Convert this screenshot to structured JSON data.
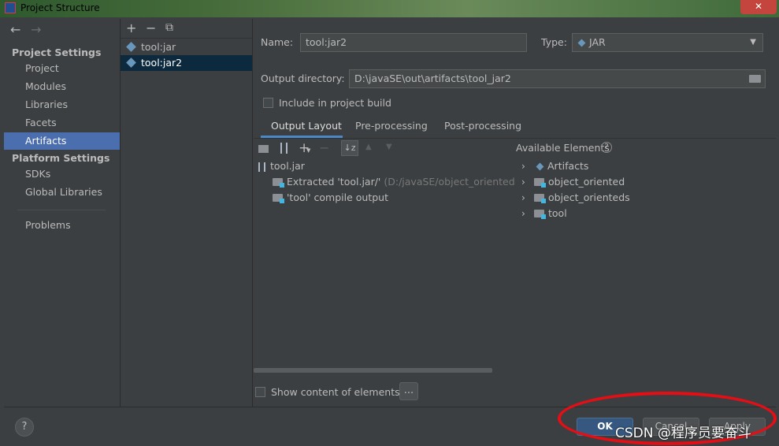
{
  "window": {
    "title": "Project Structure",
    "close_label": "✕"
  },
  "nav": {
    "back_icon": "←",
    "forward_icon": "→",
    "project_settings_header": "Project Settings",
    "project_items": [
      "Project",
      "Modules",
      "Libraries",
      "Facets",
      "Artifacts"
    ],
    "selected_item": "Artifacts",
    "platform_settings_header": "Platform Settings",
    "platform_items": [
      "SDKs",
      "Global Libraries"
    ],
    "problems": "Problems"
  },
  "artifact_list": {
    "toolbar": {
      "add": "+",
      "remove": "−",
      "copy": "⧉"
    },
    "items": [
      "tool:jar",
      "tool:jar2"
    ],
    "selected": "tool:jar2"
  },
  "detail": {
    "name_label": "Name:",
    "name_value": "tool:jar2",
    "type_label": "Type:",
    "type_value": "JAR",
    "output_dir_label": "Output directory:",
    "output_dir_value": "D:\\javaSE\\out\\artifacts\\tool_jar2",
    "include_in_build_label": "Include in project build",
    "include_in_build_checked": false,
    "tabs": [
      "Output Layout",
      "Pre-processing",
      "Post-processing"
    ],
    "active_tab": "Output Layout"
  },
  "layout_tree": {
    "root": "tool.jar",
    "children": [
      {
        "label": "Extracted 'tool.jar/'",
        "hint": "(D:/javaSE/object_orienteds/sr"
      },
      {
        "label": "'tool' compile output",
        "hint": ""
      }
    ]
  },
  "available": {
    "header": "Available Elements",
    "help_icon": "?",
    "items": [
      "Artifacts",
      "object_oriented",
      "object_orienteds",
      "tool"
    ]
  },
  "footer": {
    "show_content_label": "Show content of elements",
    "ellipsis_button": "...",
    "ok": "OK",
    "cancel": "Cancel",
    "apply": "Apply",
    "help": "?"
  },
  "watermark": "CSDN @程序员要奋斗",
  "colors": {
    "selection": "#4b6eaf",
    "accent_tab": "#4a88c7",
    "annotation_red": "#e60e15"
  }
}
